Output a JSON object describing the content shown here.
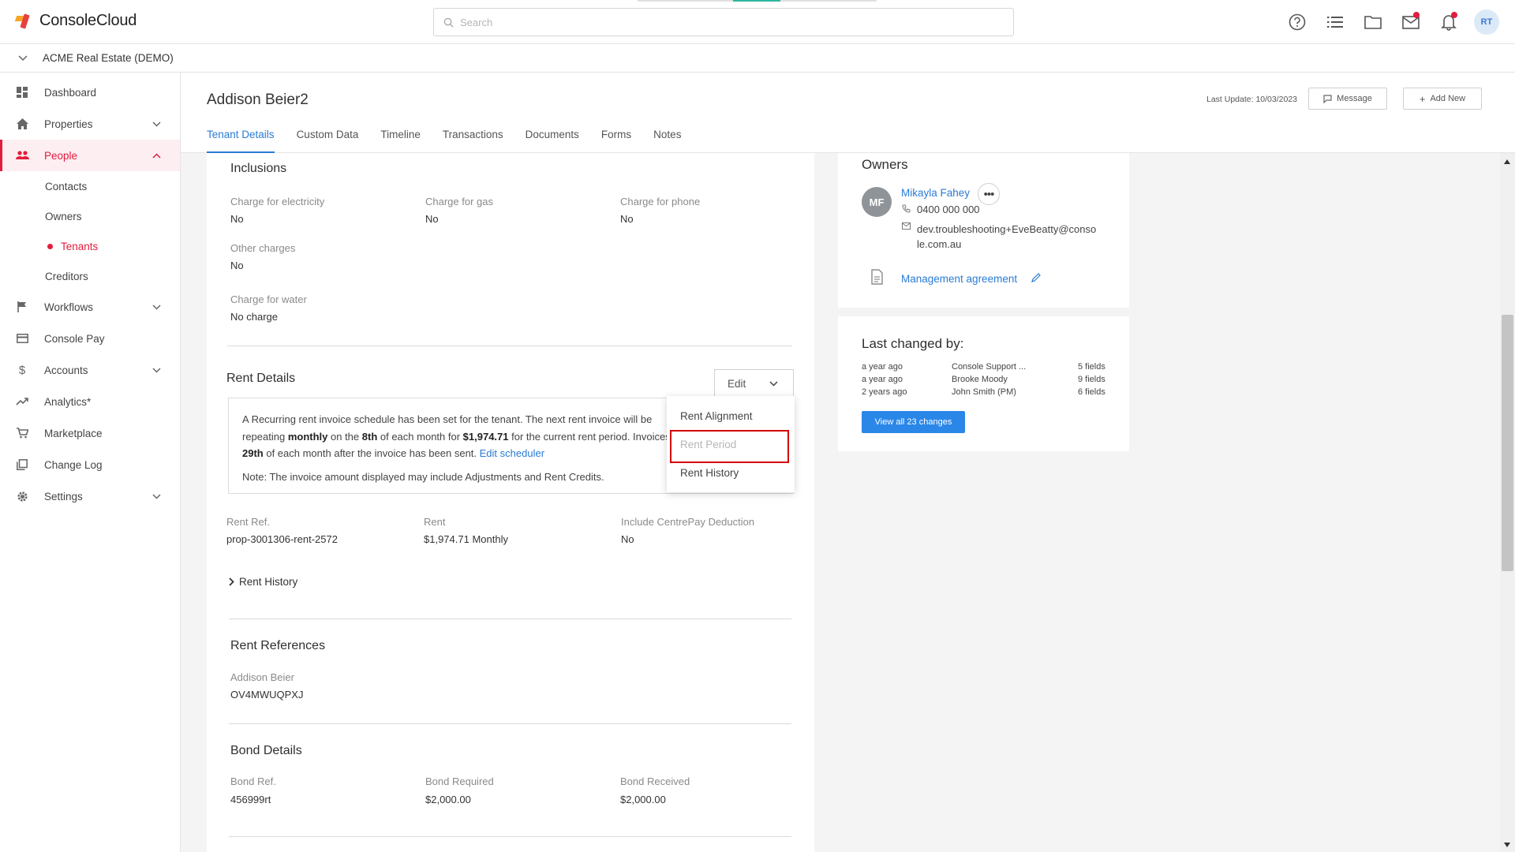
{
  "app": {
    "name": "ConsoleCloud"
  },
  "search": {
    "placeholder": "Search"
  },
  "topbar": {
    "avatar_initials": "RT"
  },
  "org": {
    "name": "ACME Real Estate (DEMO)"
  },
  "sidebar": {
    "items": [
      {
        "label": "Dashboard"
      },
      {
        "label": "Properties"
      },
      {
        "label": "People"
      },
      {
        "label": "Workflows"
      },
      {
        "label": "Console Pay"
      },
      {
        "label": "Accounts"
      },
      {
        "label": "Analytics*"
      },
      {
        "label": "Marketplace"
      },
      {
        "label": "Change Log"
      },
      {
        "label": "Settings"
      }
    ],
    "people_sub": [
      {
        "label": "Contacts"
      },
      {
        "label": "Owners"
      },
      {
        "label": "Tenants"
      },
      {
        "label": "Creditors"
      }
    ]
  },
  "header": {
    "title": "Addison Beier2",
    "last_update": "Last Update: 10/03/2023",
    "message_label": "Message",
    "add_new_label": "Add New",
    "tabs": [
      {
        "label": "Tenant Details"
      },
      {
        "label": "Custom Data"
      },
      {
        "label": "Timeline"
      },
      {
        "label": "Transactions"
      },
      {
        "label": "Documents"
      },
      {
        "label": "Forms"
      },
      {
        "label": "Notes"
      }
    ]
  },
  "inclusions": {
    "title": "Inclusions",
    "electricity": {
      "label": "Charge for electricity",
      "value": "No"
    },
    "gas": {
      "label": "Charge for gas",
      "value": "No"
    },
    "phone": {
      "label": "Charge for phone",
      "value": "No"
    },
    "other": {
      "label": "Other charges",
      "value": "No"
    },
    "water": {
      "label": "Charge for water",
      "value": "No charge"
    }
  },
  "rent_details": {
    "title": "Rent Details",
    "edit_label": "Edit",
    "info_1": "A Recurring rent invoice schedule has been set for the tenant. The next rent invoice will be",
    "info_2a": "repeating ",
    "info_2b": "monthly",
    "info_2c": " on the ",
    "info_2d": "8th",
    "info_2e": " of each month for ",
    "info_2f": "$1,974.71",
    "info_2g": " for the current rent period. Invoices will be due on the",
    "info_3a": "29th",
    "info_3b": " of each month after the invoice has been sent. ",
    "info_3link": "Edit scheduler",
    "note": "Note: The invoice amount displayed may include Adjustments and Rent Credits.",
    "rent_ref": {
      "label": "Rent Ref.",
      "value": "prop-3001306-rent-2572"
    },
    "rent": {
      "label": "Rent",
      "value": "$1,974.71 Monthly"
    },
    "centrepay": {
      "label": "Include CentrePay Deduction",
      "value": "No"
    },
    "history_label": "Rent History",
    "menu": [
      "Rent Alignment",
      "Rent Period",
      "Rent History"
    ]
  },
  "rent_references": {
    "title": "Rent References",
    "name": "Addison Beier",
    "code": "OV4MWUQPXJ"
  },
  "bond": {
    "title": "Bond Details",
    "ref": {
      "label": "Bond Ref.",
      "value": "456999rt"
    },
    "required": {
      "label": "Bond Required",
      "value": "$2,000.00"
    },
    "received": {
      "label": "Bond Received",
      "value": "$2,000.00"
    }
  },
  "owners": {
    "title": "Owners",
    "initials": "MF",
    "name": "Mikayla Fahey",
    "phone": "0400 000 000",
    "email_1": "dev.troubleshooting+EveBeatty@conso",
    "email_2": "le.com.au",
    "agreement": "Management agreement"
  },
  "last_changed": {
    "title": "Last changed by:",
    "rows": [
      {
        "when": "a year ago",
        "who": "Console Support ...",
        "fields": "5 fields"
      },
      {
        "when": "a year ago",
        "who": "Brooke Moody",
        "fields": "9 fields"
      },
      {
        "when": "2 years ago",
        "who": "John Smith (PM)",
        "fields": "6 fields"
      }
    ],
    "view_all": "View all 23 changes"
  },
  "colors": {
    "accent": "#e31c3d",
    "link": "#2a7bd4",
    "button": "#2a87e8",
    "highlight": "#d50000"
  }
}
